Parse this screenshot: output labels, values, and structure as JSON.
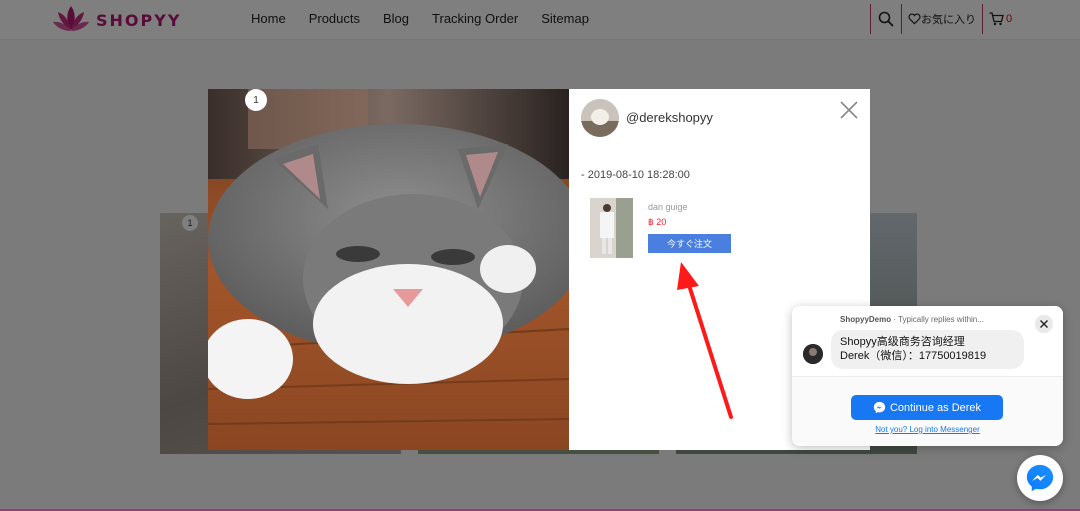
{
  "header": {
    "brand": "SHOPYY",
    "nav": [
      "Home",
      "Products",
      "Blog",
      "Tracking Order",
      "Sitemap"
    ],
    "wishlist_label": "お気に入り",
    "cart_count": "0"
  },
  "background_grid": {
    "badge": "1"
  },
  "modal": {
    "image_badge": "1",
    "username": "@derekshopyy",
    "timestamp": "- 2019-08-10 18:28:00",
    "product": {
      "name": "dan guige",
      "price": "฿ 20",
      "order_button": "今すぐ注文"
    }
  },
  "chat": {
    "page_name": "ShopyyDemo",
    "reply_note": "· Typically replies within...",
    "message_line1": "Shopyy高级商务咨询经理",
    "message_line2": "Derek（微信）：17750019819",
    "continue_label": "Continue as Derek",
    "not_you_label": "Not you? Log into Messenger"
  },
  "colors": {
    "brand": "#b0186e",
    "order_button": "#4a7fe0",
    "messenger": "#1877f2",
    "annotation_arrow": "#ff1a1a"
  }
}
